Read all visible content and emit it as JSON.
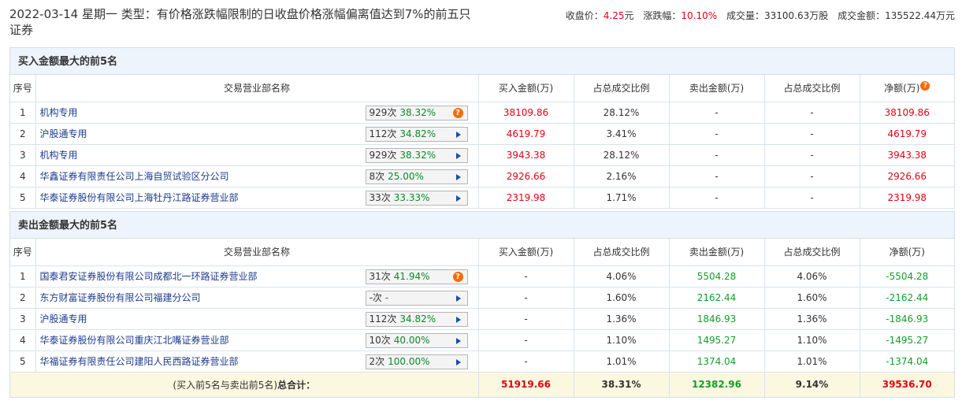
{
  "header": {
    "title": "2022-03-14 星期一 类型：有价格涨跌幅限制的日收盘价格涨幅偏离值达到7%的前五只证券",
    "close_label": "收盘价：",
    "close_value": "4.25",
    "close_unit": "元",
    "change_label": "涨跌幅：",
    "change_value": "10.10%",
    "volume_label": "成交量：",
    "volume_value": "33100.63万股",
    "amount_label": "成交金额：",
    "amount_value": "135522.44万元"
  },
  "columns": {
    "index": "序号",
    "dept": "交易营业部名称",
    "buy": "买入金额(万)",
    "buy_ratio": "占总成交比例",
    "sell": "卖出金额(万)",
    "sell_ratio": "占总成交比例",
    "net": "净额(万)"
  },
  "buy_section": {
    "title": "买入金额最大的前5名",
    "rows": [
      {
        "index": "1",
        "dept": "机构专用",
        "times": "929次",
        "rate": "38.32%",
        "icon": "question-icon",
        "buy": "38109.86",
        "buy_ratio": "28.12%",
        "sell": "-",
        "sell_ratio": "-",
        "net": "38109.86"
      },
      {
        "index": "2",
        "dept": "沪股通专用",
        "times": "112次",
        "rate": "34.82%",
        "icon": "arrow-right-icon",
        "buy": "4619.79",
        "buy_ratio": "3.41%",
        "sell": "-",
        "sell_ratio": "-",
        "net": "4619.79"
      },
      {
        "index": "3",
        "dept": "机构专用",
        "times": "929次",
        "rate": "38.32%",
        "icon": "arrow-right-icon",
        "buy": "3943.38",
        "buy_ratio": "28.12%",
        "sell": "-",
        "sell_ratio": "-",
        "net": "3943.38"
      },
      {
        "index": "4",
        "dept": "华鑫证券有限责任公司上海自贸试验区分公司",
        "times": "8次",
        "rate": "25.00%",
        "icon": "arrow-right-icon",
        "buy": "2926.66",
        "buy_ratio": "2.16%",
        "sell": "-",
        "sell_ratio": "-",
        "net": "2926.66"
      },
      {
        "index": "5",
        "dept": "华泰证券股份有限公司上海牡丹江路证券营业部",
        "times": "33次",
        "rate": "33.33%",
        "icon": "arrow-right-icon",
        "buy": "2319.98",
        "buy_ratio": "1.71%",
        "sell": "-",
        "sell_ratio": "-",
        "net": "2319.98"
      }
    ]
  },
  "sell_section": {
    "title": "卖出金额最大的前5名",
    "net_label": "净额(万)",
    "rows": [
      {
        "index": "1",
        "dept": "国泰君安证券股份有限公司成都北一环路证券营业部",
        "times": "31次",
        "rate": "41.94%",
        "icon": "question-icon",
        "buy": "-",
        "buy_ratio": "4.06%",
        "sell": "5504.28",
        "sell_ratio": "4.06%",
        "net": "-5504.28"
      },
      {
        "index": "2",
        "dept": "东方财富证券股份有限公司福建分公司",
        "times": "-次",
        "rate": "-",
        "icon": "arrow-right-icon",
        "buy": "-",
        "buy_ratio": "1.60%",
        "sell": "2162.44",
        "sell_ratio": "1.60%",
        "net": "-2162.44"
      },
      {
        "index": "3",
        "dept": "沪股通专用",
        "times": "112次",
        "rate": "34.82%",
        "icon": "arrow-right-icon",
        "buy": "-",
        "buy_ratio": "1.36%",
        "sell": "1846.93",
        "sell_ratio": "1.36%",
        "net": "-1846.93"
      },
      {
        "index": "4",
        "dept": "华泰证券股份有限公司重庆江北嘴证券营业部",
        "times": "10次",
        "rate": "40.00%",
        "icon": "arrow-right-icon",
        "buy": "-",
        "buy_ratio": "1.10%",
        "sell": "1495.27",
        "sell_ratio": "1.10%",
        "net": "-1495.27"
      },
      {
        "index": "5",
        "dept": "华福证券有限责任公司建阳人民西路证券营业部",
        "times": "2次",
        "rate": "100.00%",
        "icon": "arrow-right-icon",
        "buy": "-",
        "buy_ratio": "1.01%",
        "sell": "1374.04",
        "sell_ratio": "1.01%",
        "net": "-1374.04"
      }
    ]
  },
  "total": {
    "label_prefix": "(买入前5名与卖出前5名)",
    "label_bold": "总合计：",
    "buy": "51919.66",
    "buy_ratio": "38.31%",
    "sell": "12382.96",
    "sell_ratio": "9.14%",
    "net": "39536.70"
  },
  "colors": {
    "up": "#e60012",
    "down": "#129e2a",
    "section_bg": "#eef4fb",
    "total_bg": "#fcf8e0"
  }
}
